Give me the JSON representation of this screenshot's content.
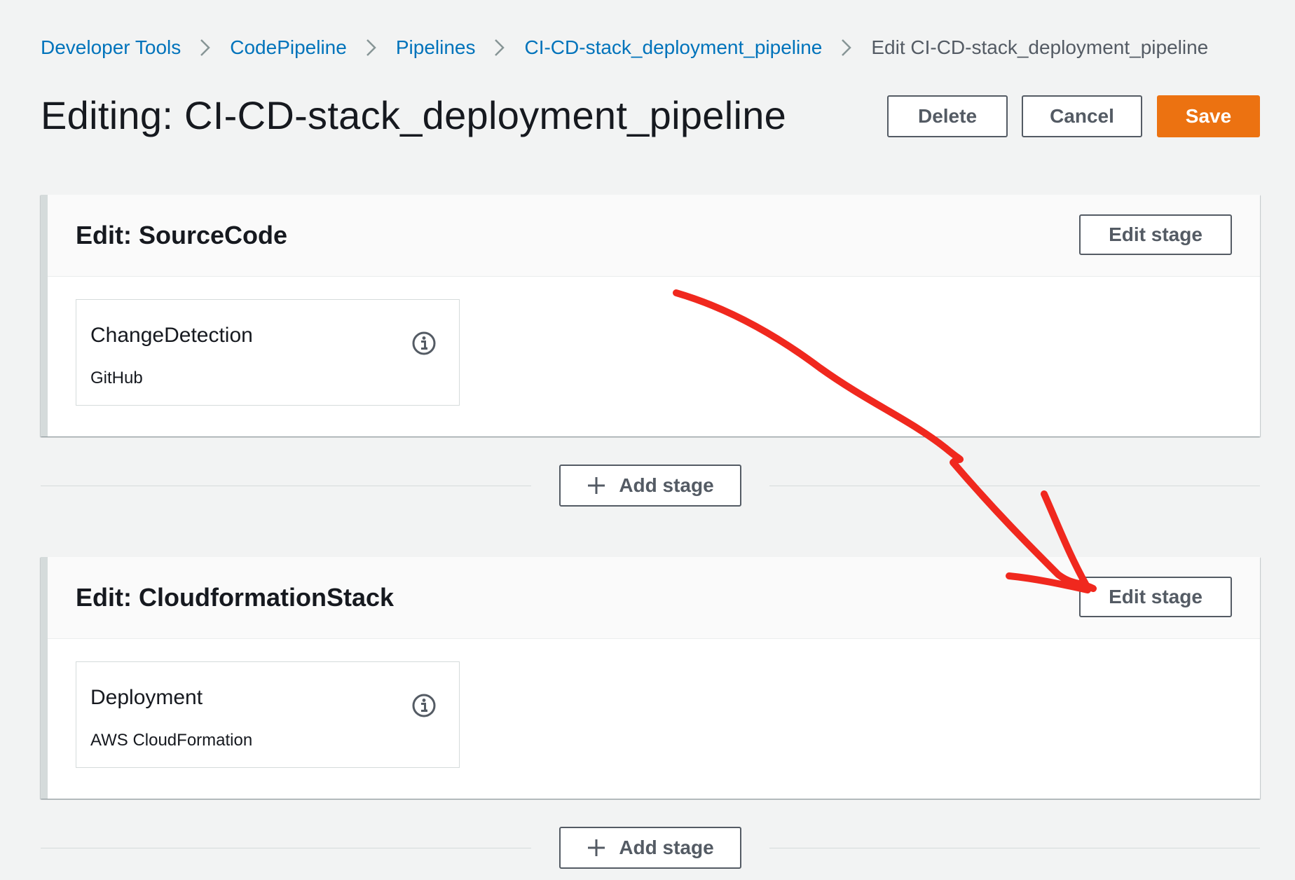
{
  "breadcrumbs": [
    {
      "label": "Developer Tools",
      "link": true
    },
    {
      "label": "CodePipeline",
      "link": true
    },
    {
      "label": "Pipelines",
      "link": true
    },
    {
      "label": "CI-CD-stack_deployment_pipeline",
      "link": true
    },
    {
      "label": "Edit CI-CD-stack_deployment_pipeline",
      "link": false
    }
  ],
  "header": {
    "title": "Editing: CI-CD-stack_deployment_pipeline",
    "delete_label": "Delete",
    "cancel_label": "Cancel",
    "save_label": "Save"
  },
  "stages": [
    {
      "title": "Edit: SourceCode",
      "edit_label": "Edit stage",
      "action": {
        "name": "ChangeDetection",
        "provider": "GitHub",
        "icon": "info-icon"
      }
    },
    {
      "title": "Edit: CloudformationStack",
      "edit_label": "Edit stage",
      "action": {
        "name": "Deployment",
        "provider": "AWS CloudFormation",
        "icon": "info-icon"
      }
    }
  ],
  "add_stage_label": "Add stage",
  "colors": {
    "link": "#0073bb",
    "primary_button": "#ec7211",
    "annotation_arrow": "#f0281e",
    "page_background": "#f2f3f3"
  }
}
